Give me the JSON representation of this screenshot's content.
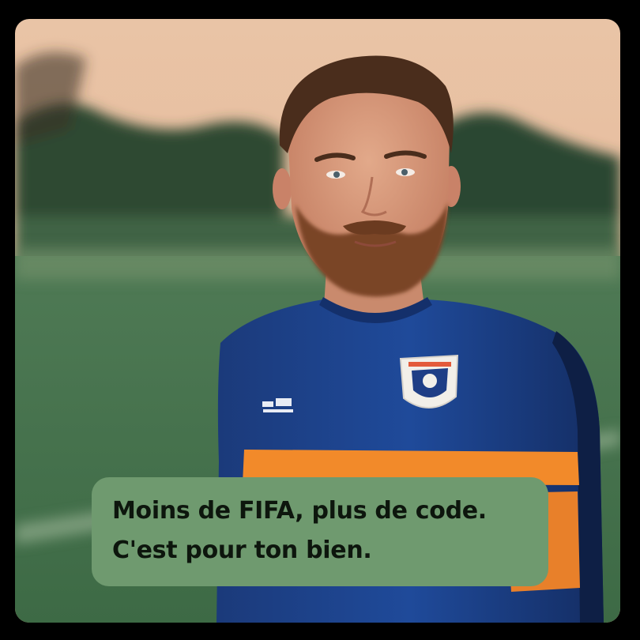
{
  "caption": {
    "line1": "Moins de FIFA, plus de code.",
    "line2": "C'est pour ton bien."
  },
  "photo": {
    "subject": "bearded-man-in-football-jersey",
    "jersey_colors": [
      "#1a3f86",
      "#f28a2a"
    ],
    "caption_bg": "#6f9a6f"
  }
}
